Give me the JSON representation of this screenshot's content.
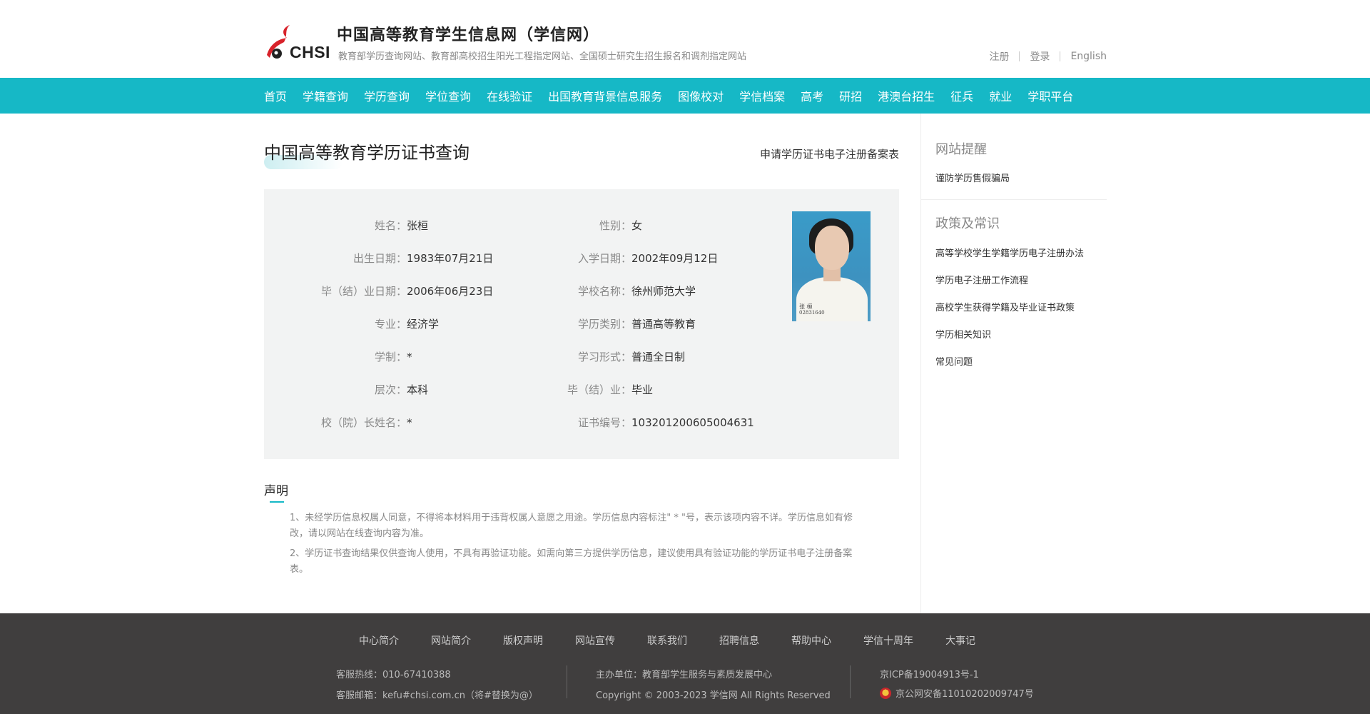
{
  "header": {
    "logo_text": "CHSI",
    "site_title": "中国高等教育学生信息网（学信网）",
    "site_subtitle": "教育部学历查询网站、教育部高校招生阳光工程指定网站、全国硕士研究生招生报名和调剂指定网站",
    "top_links": [
      "注册",
      "登录",
      "English"
    ]
  },
  "nav": {
    "items": [
      "首页",
      "学籍查询",
      "学历查询",
      "学位查询",
      "在线验证",
      "出国教育背景信息服务",
      "图像校对",
      "学信档案",
      "高考",
      "研招",
      "港澳台招生",
      "征兵",
      "就业",
      "学职平台"
    ]
  },
  "main": {
    "title": "中国高等教育学历证书查询",
    "apply_link": "申请学历证书电子注册备案表",
    "fields_left": [
      {
        "label": "姓名：",
        "value": "张桓"
      },
      {
        "label": "出生日期：",
        "value": "1983年07月21日"
      },
      {
        "label": "毕（结）业日期：",
        "value": "2006年06月23日"
      },
      {
        "label": "专业：",
        "value": "经济学"
      },
      {
        "label": "学制：",
        "value": "*"
      },
      {
        "label": "层次：",
        "value": "本科"
      },
      {
        "label": "校（院）长姓名：",
        "value": "*"
      }
    ],
    "fields_right": [
      {
        "label": "性别：",
        "value": "女"
      },
      {
        "label": "入学日期：",
        "value": "2002年09月12日"
      },
      {
        "label": "学校名称：",
        "value": "徐州师范大学"
      },
      {
        "label": "学历类别：",
        "value": "普通高等教育"
      },
      {
        "label": "学习形式：",
        "value": "普通全日制"
      },
      {
        "label": "毕（结）业：",
        "value": "毕业"
      },
      {
        "label": "证书编号：",
        "value": "103201200605004631"
      }
    ],
    "photo_caption_name": "张 桓",
    "photo_caption_id": "02831640",
    "declaration_title": "声明",
    "declaration_1a": "1、未经学历信息权属人同意，不得将本材料用于违背权属人意愿之用途。学历信息内容标注\" * \"号，表示该项内容不详。学历信息如有修",
    "declaration_1b": "改，请以网站在线查询内容为准。",
    "declaration_2a": "2、学历证书查询结果仅供查询人使用，不具有再验证功能。如需向第三方提供学历信息，建议使用具有验证功能的学历证书电子注册备案",
    "declaration_2b": "表。"
  },
  "sidebar": {
    "reminder_title": "网站提醒",
    "reminder_item": "谨防学历售假骗局",
    "policy_title": "政策及常识",
    "policy_items": [
      "高等学校学生学籍学历电子注册办法",
      "学历电子注册工作流程",
      "高校学生获得学籍及毕业证书政策",
      "学历相关知识",
      "常见问题"
    ]
  },
  "footer": {
    "links": [
      "中心简介",
      "网站简介",
      "版权声明",
      "网站宣传",
      "联系我们",
      "招聘信息",
      "帮助中心",
      "学信十周年",
      "大事记"
    ],
    "hotline": "客服热线：010-67410388",
    "email": "客服邮箱：kefu#chsi.com.cn（将#替换为@）",
    "sponsor": "主办单位：教育部学生服务与素质发展中心",
    "copyright": "Copyright © 2003-2023 学信网 All Rights Reserved",
    "icp": "京ICP备19004913号-1",
    "police": "京公网安备11010202009747号"
  },
  "colors": {
    "nav_bg": "#16b8c6",
    "footer_bg": "#403e3e",
    "info_bg": "#f2f3f3"
  }
}
